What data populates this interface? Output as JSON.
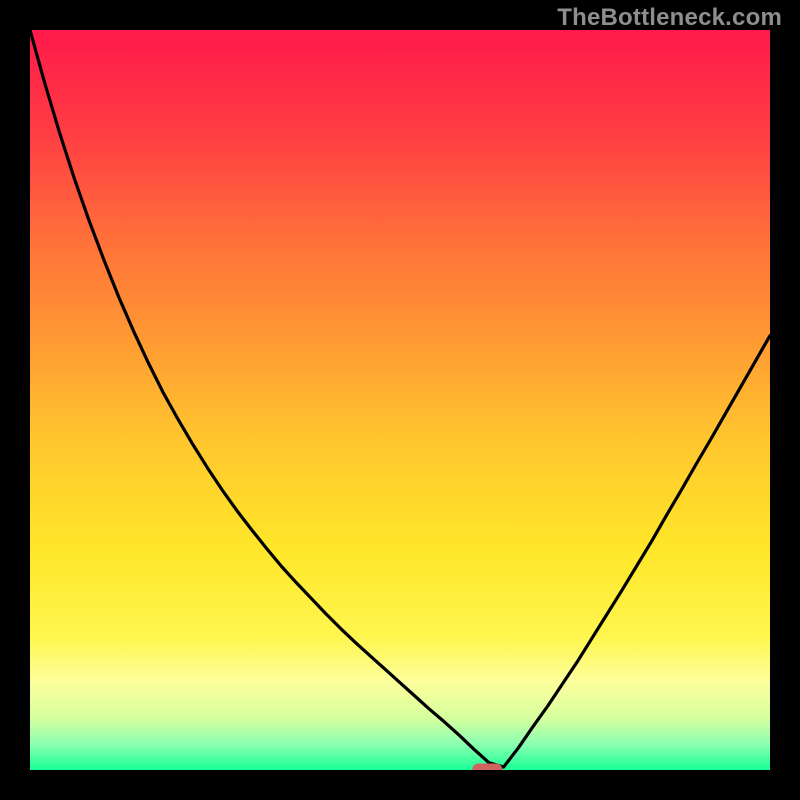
{
  "watermark": "TheBottleneck.com",
  "chart_data": {
    "type": "line",
    "x": [
      0.0,
      0.02,
      0.04,
      0.06,
      0.08,
      0.1,
      0.12,
      0.14,
      0.16,
      0.18,
      0.2,
      0.22,
      0.24,
      0.26,
      0.28,
      0.3,
      0.32,
      0.34,
      0.36,
      0.38,
      0.4,
      0.42,
      0.44,
      0.46,
      0.48,
      0.5,
      0.52,
      0.54,
      0.56,
      0.58,
      0.6,
      0.62,
      0.64,
      0.66,
      0.68,
      0.7,
      0.72,
      0.74,
      0.76,
      0.78,
      0.8,
      0.82,
      0.84,
      0.86,
      0.88,
      0.9,
      0.92,
      0.94,
      0.96,
      0.98,
      1.0
    ],
    "values": [
      1.0,
      0.928,
      0.861,
      0.799,
      0.742,
      0.689,
      0.639,
      0.593,
      0.55,
      0.51,
      0.474,
      0.44,
      0.408,
      0.378,
      0.35,
      0.324,
      0.299,
      0.275,
      0.253,
      0.232,
      0.211,
      0.191,
      0.172,
      0.154,
      0.136,
      0.118,
      0.1,
      0.082,
      0.065,
      0.047,
      0.028,
      0.01,
      0.004,
      0.03,
      0.059,
      0.087,
      0.117,
      0.147,
      0.179,
      0.211,
      0.243,
      0.276,
      0.309,
      0.344,
      0.378,
      0.413,
      0.447,
      0.482,
      0.517,
      0.552,
      0.587
    ],
    "marker": {
      "x": 0.618,
      "y": 0.0,
      "color": "#d1645f"
    },
    "title": "",
    "xlabel": "",
    "ylabel": "",
    "xlim": [
      0,
      1
    ],
    "ylim": [
      0,
      1
    ],
    "background": {
      "type": "vertical-gradient",
      "stops": [
        {
          "offset": 0.0,
          "color": "#ff1a4b"
        },
        {
          "offset": 0.14,
          "color": "#ff3d43"
        },
        {
          "offset": 0.28,
          "color": "#ff6f3a"
        },
        {
          "offset": 0.42,
          "color": "#ff9a33"
        },
        {
          "offset": 0.56,
          "color": "#ffc82e"
        },
        {
          "offset": 0.7,
          "color": "#ffe629"
        },
        {
          "offset": 0.82,
          "color": "#fff64e"
        },
        {
          "offset": 0.88,
          "color": "#fdff9c"
        },
        {
          "offset": 0.93,
          "color": "#d6ff9e"
        },
        {
          "offset": 0.965,
          "color": "#8bffb0"
        },
        {
          "offset": 1.0,
          "color": "#19ff97"
        }
      ]
    }
  }
}
